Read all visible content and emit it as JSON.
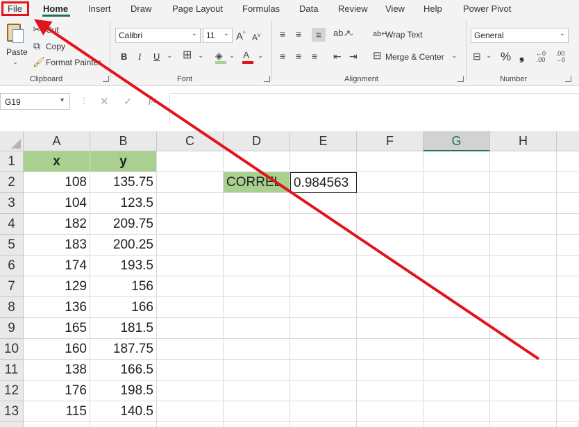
{
  "tabs": [
    "File",
    "Home",
    "Insert",
    "Draw",
    "Page Layout",
    "Formulas",
    "Data",
    "Review",
    "View",
    "Help",
    "Power Pivot"
  ],
  "clipboard": {
    "paste": "Paste",
    "cut": "Cut",
    "copy": "Copy",
    "format_painter": "Format Painter",
    "label": "Clipboard"
  },
  "font": {
    "family": "Calibri",
    "size": "11",
    "label": "Font",
    "bold": "B",
    "italic": "I",
    "underline": "U"
  },
  "alignment": {
    "wrap_text": "Wrap Text",
    "merge_center": "Merge & Center",
    "label": "Alignment"
  },
  "number": {
    "format": "General",
    "label": "Number",
    "percent": "%",
    "comma": "❟"
  },
  "formula_bar": {
    "name_box": "G19",
    "cancel": "✕",
    "enter": "✓",
    "fx": "fx",
    "formula": ""
  },
  "sheet": {
    "columns": [
      "A",
      "B",
      "C",
      "D",
      "E",
      "F",
      "G",
      "H"
    ],
    "selected_column": "G",
    "rows": [
      "1",
      "2",
      "3",
      "4",
      "5",
      "6",
      "7",
      "8",
      "9",
      "10",
      "11",
      "12",
      "13"
    ],
    "header_x": "x",
    "header_y": "y",
    "x_values": [
      "108",
      "104",
      "182",
      "183",
      "174",
      "129",
      "136",
      "165",
      "160",
      "138",
      "176",
      "115"
    ],
    "y_values": [
      "135.75",
      "123.5",
      "209.75",
      "200.25",
      "193.5",
      "156",
      "166",
      "181.5",
      "187.75",
      "166.5",
      "198.5",
      "140.5"
    ],
    "correl_label": "CORREL",
    "correl_value": "0.984563"
  },
  "colors": {
    "accent": "#217346",
    "header_fill": "#a9d08e",
    "annotation": "#e2141b"
  }
}
